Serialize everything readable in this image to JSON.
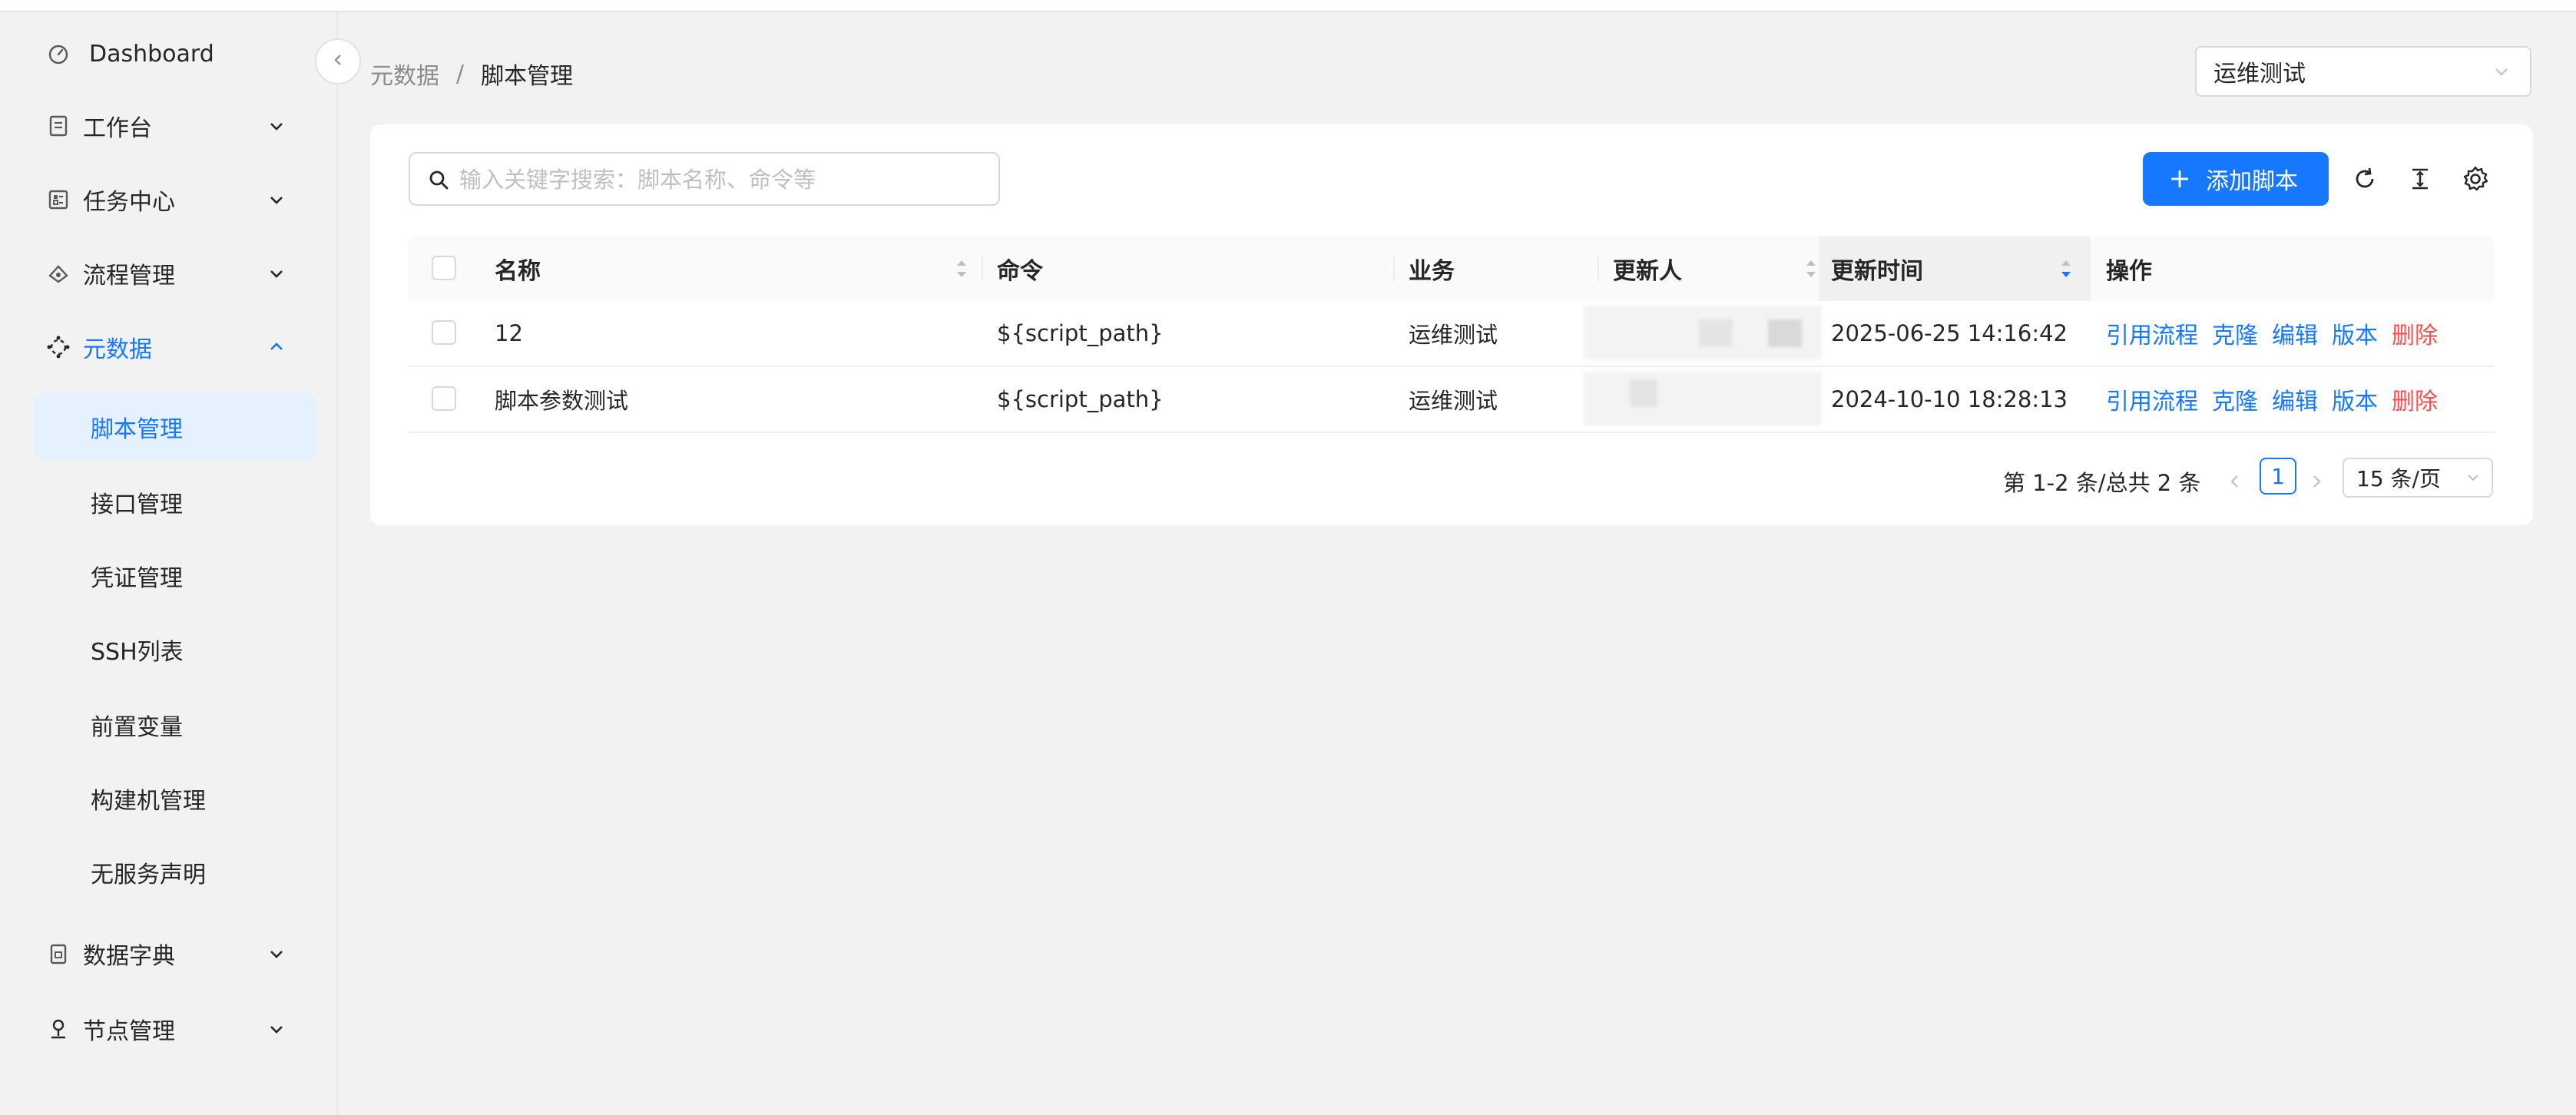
{
  "sidebar": {
    "items": [
      {
        "label": "Dashboard",
        "icon": "dashboard-icon"
      },
      {
        "label": "工作台",
        "icon": "workbench-icon"
      },
      {
        "label": "任务中心",
        "icon": "task-icon"
      },
      {
        "label": "流程管理",
        "icon": "flow-icon"
      },
      {
        "label": "元数据",
        "icon": "metadata-icon"
      },
      {
        "label": "数据字典",
        "icon": "dictionary-icon"
      },
      {
        "label": "节点管理",
        "icon": "node-icon"
      }
    ],
    "sub_items": [
      {
        "label": "脚本管理"
      },
      {
        "label": "接口管理"
      },
      {
        "label": "凭证管理"
      },
      {
        "label": "SSH列表"
      },
      {
        "label": "前置变量"
      },
      {
        "label": "构建机管理"
      },
      {
        "label": "无服务声明"
      }
    ]
  },
  "header": {
    "breadcrumb": [
      "元数据",
      "脚本管理"
    ],
    "breadcrumb_sep": "/",
    "business_select": "运维测试"
  },
  "toolbar": {
    "search_placeholder": "输入关键字搜索：脚本名称、命令等",
    "add_label": "添加脚本"
  },
  "table": {
    "columns": {
      "name": "名称",
      "command": "命令",
      "business": "业务",
      "updater": "更新人",
      "updated_at": "更新时间",
      "actions": "操作"
    },
    "rows": [
      {
        "name": "12",
        "command": "${script_path}",
        "business": "运维测试",
        "updated_at": "2025-06-25 14:16:42"
      },
      {
        "name": "脚本参数测试",
        "command": "${script_path}",
        "business": "运维测试",
        "updated_at": "2024-10-10 18:28:13"
      }
    ],
    "actions": {
      "ref_flow": "引用流程",
      "clone": "克隆",
      "edit": "编辑",
      "version": "版本",
      "delete": "删除"
    }
  },
  "pagination": {
    "total_text": "第 1-2 条/总共 2 条",
    "current_page": "1",
    "page_size": "15 条/页"
  },
  "colors": {
    "primary": "#1677ff",
    "danger": "#ff4d4f"
  }
}
